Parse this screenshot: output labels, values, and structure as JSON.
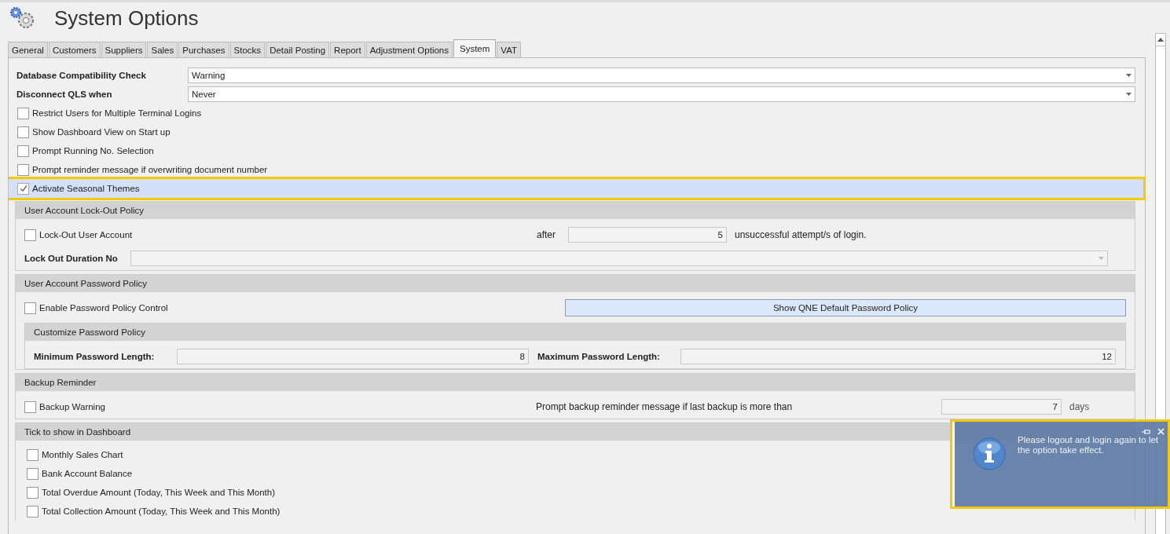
{
  "window": {
    "title": "System Options"
  },
  "tabs": [
    {
      "label": "General",
      "selected": false
    },
    {
      "label": "Customers",
      "selected": false
    },
    {
      "label": "Suppliers",
      "selected": false
    },
    {
      "label": "Sales",
      "selected": false
    },
    {
      "label": "Purchases",
      "selected": false
    },
    {
      "label": "Stocks",
      "selected": false
    },
    {
      "label": "Detail Posting",
      "selected": false
    },
    {
      "label": "Report",
      "selected": false
    },
    {
      "label": "Adjustment Options",
      "selected": false
    },
    {
      "label": "System",
      "selected": true
    },
    {
      "label": "VAT",
      "selected": false
    }
  ],
  "fields": [
    {
      "label": "Database Compatibility Check",
      "value": "Warning"
    },
    {
      "label": "Disconnect QLS when",
      "value": "Never"
    }
  ],
  "options": [
    {
      "label": "Restrict Users for Multiple Terminal Logins",
      "checked": false,
      "highlighted": false
    },
    {
      "label": "Show Dashboard View on Start up",
      "checked": false,
      "highlighted": false
    },
    {
      "label": "Prompt Running No. Selection",
      "checked": false,
      "highlighted": false
    },
    {
      "label": "Prompt reminder message if overwriting document number",
      "checked": false,
      "highlighted": false
    },
    {
      "label": "Activate Seasonal Themes",
      "checked": true,
      "highlighted": true
    }
  ],
  "lockout": {
    "title": "User Account Lock-Out Policy",
    "checkbox": {
      "label": "Lock-Out User Account",
      "checked": false
    },
    "after_label": "after",
    "attempts": "5",
    "attempts_suffix": "unsuccessful attempt/s of login.",
    "duration_label": "Lock Out Duration No"
  },
  "password": {
    "title": "User Account Password Policy",
    "checkbox": {
      "label": "Enable Password Policy Control",
      "checked": false
    },
    "button": "Show QNE Default Password Policy",
    "customize": {
      "title": "Customize Password Policy",
      "min_label": "Minimum Password Length:",
      "min_value": "8",
      "max_label": "Maximum Password Length:",
      "max_value": "12"
    }
  },
  "backup": {
    "title": "Backup Reminder",
    "checkbox": {
      "label": "Backup Warning",
      "checked": false
    },
    "prompt_label": "Prompt backup reminder message if last backup is more than",
    "days_value": "7",
    "days_label": "days"
  },
  "dashboard": {
    "title": "Tick to show in Dashboard",
    "items": [
      {
        "label": "Monthly Sales Chart",
        "checked": false
      },
      {
        "label": "Bank Account Balance",
        "checked": false
      },
      {
        "label": "Total Overdue Amount (Today, This Week and This Month)",
        "checked": false
      },
      {
        "label": "Total Collection Amount (Today, This Week and This Month)",
        "checked": false
      }
    ]
  },
  "notification": {
    "message": "Please logout and login again to let the option take effect.",
    "highlighted": true
  }
}
